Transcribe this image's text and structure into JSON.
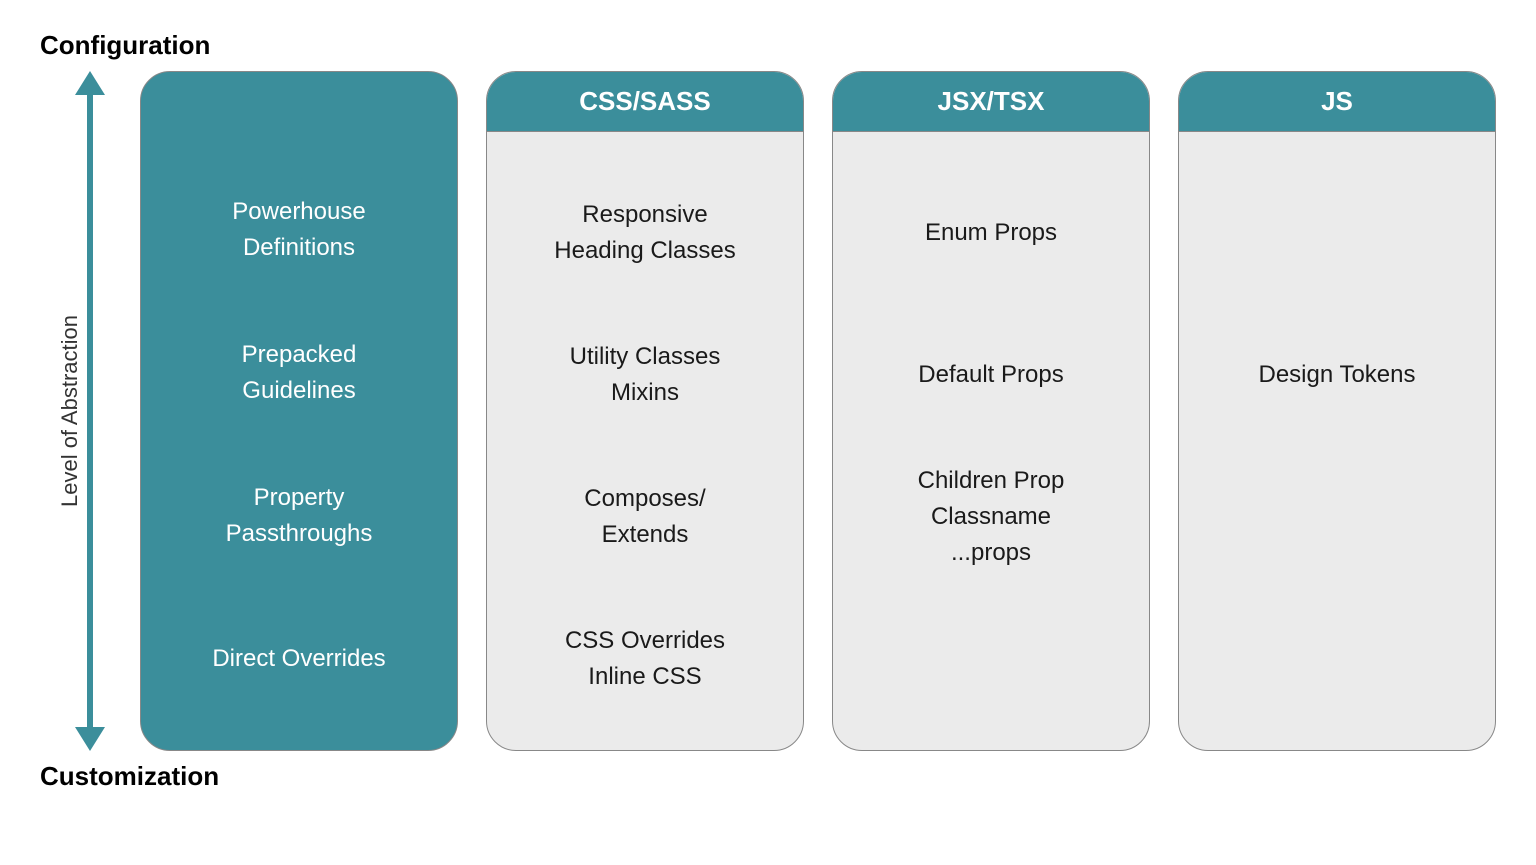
{
  "labels": {
    "top": "Configuration",
    "bottom": "Customization",
    "axis": "Level of Abstraction"
  },
  "columns": {
    "labels": {
      "rows": [
        [
          "Powerhouse",
          "Definitions"
        ],
        [
          "Prepacked",
          "Guidelines"
        ],
        [
          "Property",
          "Passthroughs"
        ],
        [
          "Direct Overrides"
        ]
      ]
    },
    "css": {
      "header": "CSS/SASS",
      "rows": [
        [
          "Responsive",
          "Heading Classes"
        ],
        [
          "Utility Classes",
          "Mixins"
        ],
        [
          "Composes/",
          "Extends"
        ],
        [
          "CSS Overrides",
          "Inline CSS"
        ]
      ]
    },
    "jsx": {
      "header": "JSX/TSX",
      "rows": [
        [
          "Enum Props"
        ],
        [
          "Default Props"
        ],
        [
          "Children Prop",
          "Classname",
          "...props"
        ],
        [
          ""
        ]
      ]
    },
    "js": {
      "header": "JS",
      "rows": [
        [
          ""
        ],
        [
          "Design Tokens"
        ],
        [
          ""
        ],
        [
          ""
        ]
      ]
    }
  },
  "colors": {
    "teal": "#3b8e9b",
    "lightgray": "#ebebeb"
  }
}
